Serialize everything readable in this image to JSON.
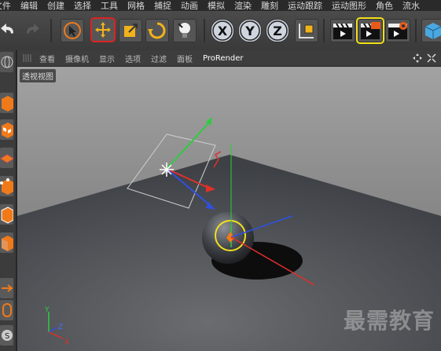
{
  "menu": {
    "items": [
      "文件",
      "编辑",
      "创建",
      "选择",
      "工具",
      "网格",
      "捕捉",
      "动画",
      "模拟",
      "渲染",
      "雕刻",
      "运动跟踪",
      "运动图形",
      "角色",
      "流水"
    ]
  },
  "toolbar": {
    "axis_x": "X",
    "axis_y": "Y",
    "axis_z": "Z"
  },
  "viewport_menu": {
    "items": [
      "查看",
      "摄像机",
      "显示",
      "选项",
      "过滤",
      "面板",
      "ProRender"
    ]
  },
  "viewport": {
    "label": "透视视图",
    "axis_labels": {
      "y": "Y",
      "z": "Z",
      "x": "X"
    }
  },
  "watermark": "最需教育",
  "colors": {
    "selected_outline": "#dd2222",
    "axis_x": "#e0302a",
    "axis_y": "#2ecc40",
    "axis_z": "#3050e0",
    "selection_ring": "#f2e01a"
  }
}
